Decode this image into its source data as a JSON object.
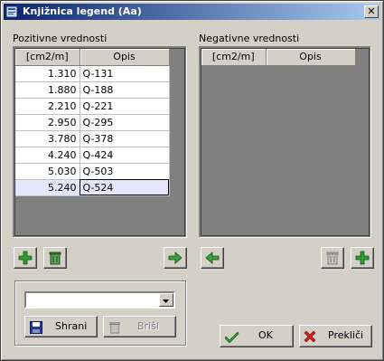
{
  "window": {
    "title": "Knjižnica legend (Aa)"
  },
  "positive": {
    "label": "Pozitivne vrednosti",
    "columns": [
      "[cm2/m]",
      "Opis"
    ],
    "rows": [
      {
        "value": "1.310",
        "desc": "Q-131"
      },
      {
        "value": "1.880",
        "desc": "Q-188"
      },
      {
        "value": "2.210",
        "desc": "Q-221"
      },
      {
        "value": "2.950",
        "desc": "Q-295"
      },
      {
        "value": "3.780",
        "desc": "Q-378"
      },
      {
        "value": "4.240",
        "desc": "Q-424"
      },
      {
        "value": "5.030",
        "desc": "Q-503"
      },
      {
        "value": "5.240",
        "desc": "Q-524"
      }
    ],
    "selected_row": 7
  },
  "negative": {
    "label": "Negativne vrednosti",
    "columns": [
      "[cm2/m]",
      "Opis"
    ],
    "rows": []
  },
  "legend_combo": {
    "value": ""
  },
  "buttons": {
    "save": "Shrani",
    "delete": "Briši",
    "ok": "OK",
    "cancel": "Prekliči"
  },
  "colors": {
    "add": "#2e9e2e",
    "arrow": "#3aa03a",
    "cancel": "#d42020",
    "save": "#1e3ca0"
  }
}
